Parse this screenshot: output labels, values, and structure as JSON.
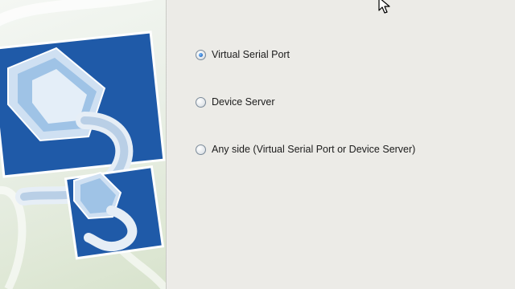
{
  "options": [
    {
      "label": "Virtual Serial Port",
      "checked": true
    },
    {
      "label": "Device Server",
      "checked": false
    },
    {
      "label": "Any side (Virtual Serial Port or Device Server)",
      "checked": false
    }
  ],
  "colors": {
    "banner_blue": "#1f5aa8",
    "radio_selected": "#2a6fc6",
    "background": "#ecebe7"
  },
  "icons": [
    "network-cable-icon",
    "mouse-cursor-icon"
  ]
}
